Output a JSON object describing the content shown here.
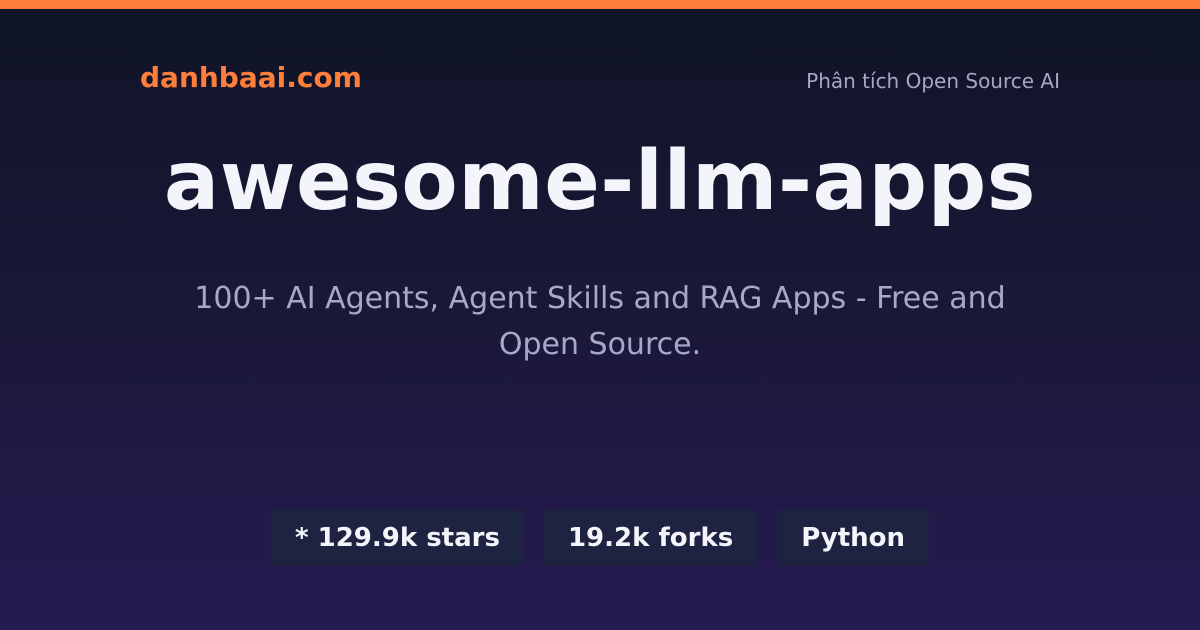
{
  "header": {
    "brand": "danhbaai.com",
    "tagline": "Phân tích Open Source AI"
  },
  "repo": {
    "title": "awesome-llm-apps",
    "description": "100+ AI Agents, Agent Skills and RAG Apps - Free and Open Source."
  },
  "badges": {
    "stars": "* 129.9k stars",
    "forks": "19.2k forks",
    "language": "Python"
  },
  "colors": {
    "accent": "#ff7f3a",
    "background_top": "#0f1426",
    "background_bottom": "#261b52",
    "badge_bg": "#1e2440"
  }
}
